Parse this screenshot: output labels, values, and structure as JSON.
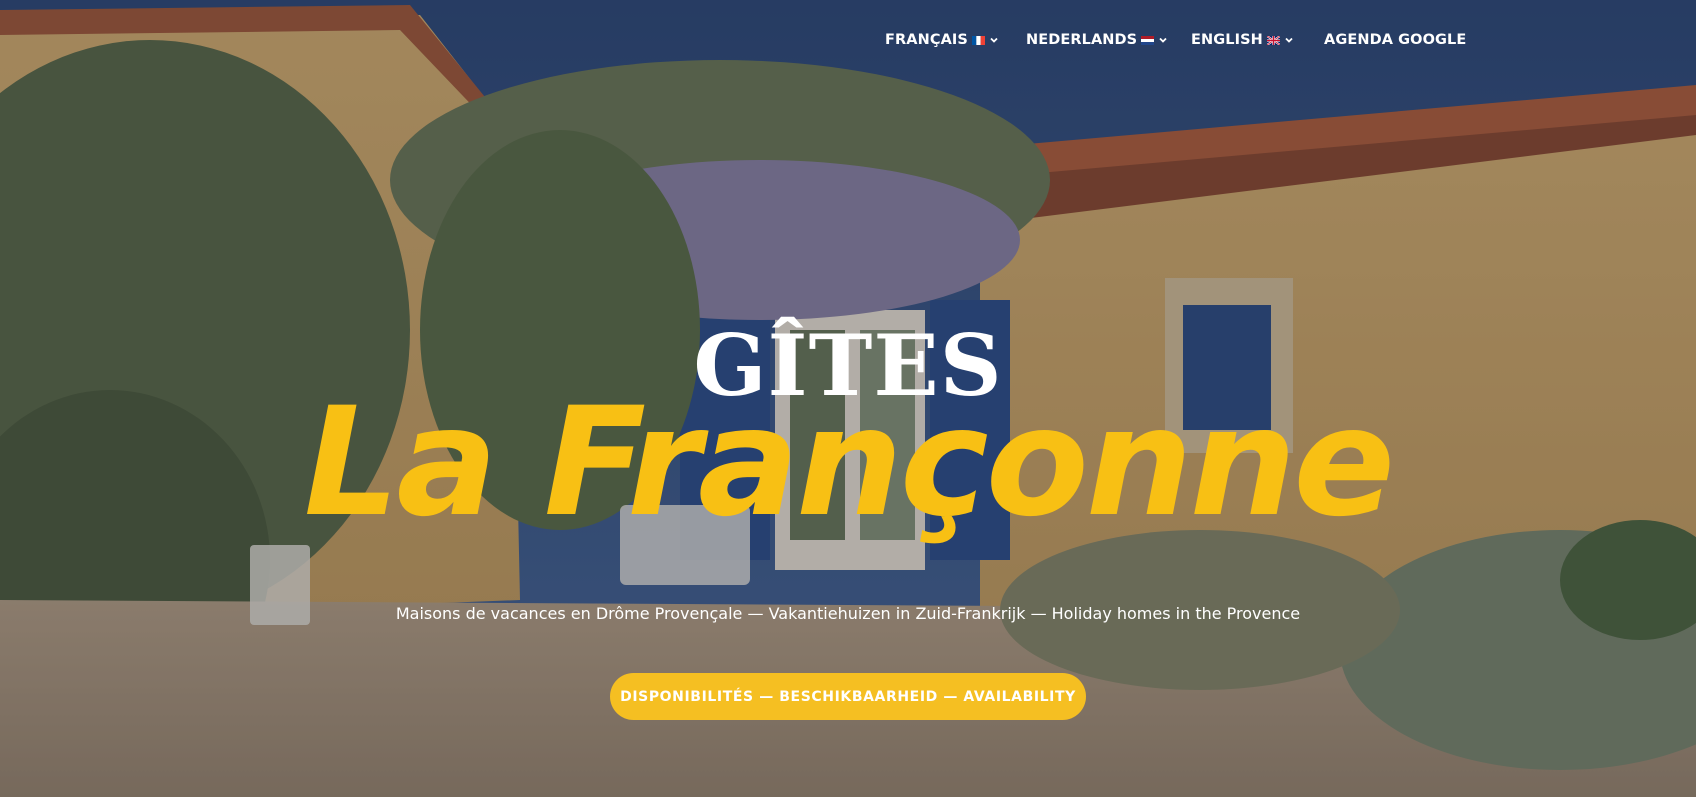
{
  "site": {
    "brand_small": "GÎTES",
    "brand_large": "La Françonne",
    "tagline": "Maisons de vacances en Drôme Provençale — Vakantiehuizen in Zuid-Frankrijk — Holiday homes in the Provence"
  },
  "nav": {
    "items": [
      {
        "label": "FRANÇAIS",
        "flag": "flag-fr-icon",
        "dropdown": true
      },
      {
        "label": "NEDERLANDS",
        "flag": "flag-nl-icon",
        "dropdown": true
      },
      {
        "label": "ENGLISH",
        "flag": "flag-uk-icon",
        "dropdown": true
      },
      {
        "label": "AGENDA GOOGLE",
        "flag": "",
        "dropdown": false
      }
    ]
  },
  "cta": {
    "label": "DISPONIBILITÉS — BESCHIKBAARHEID — AVAILABILITY"
  },
  "colors": {
    "accent": "#F5BF22",
    "title_script": "#F8C014",
    "text": "#FFFFFF"
  },
  "background": "hero-photo-provencal-house-with-wisteria"
}
